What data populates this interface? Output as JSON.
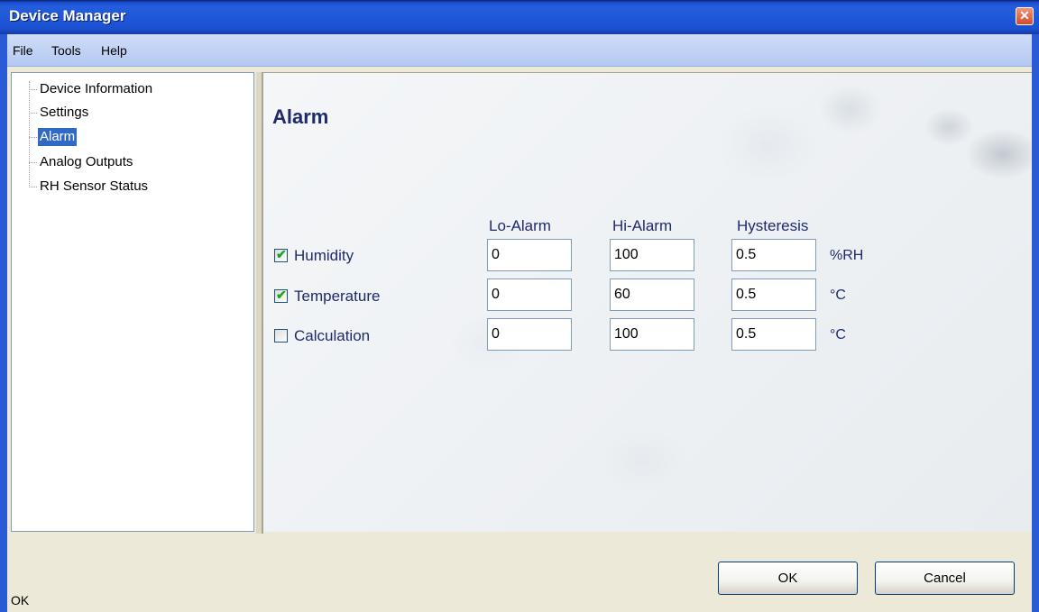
{
  "window": {
    "title": "Device Manager",
    "close_glyph": "✕"
  },
  "menu": {
    "items": [
      "File",
      "Tools",
      "Help"
    ]
  },
  "tree": {
    "items": [
      "Device Information",
      "Settings",
      "Alarm",
      "Analog Outputs",
      "RH Sensor Status"
    ],
    "selected": "Alarm"
  },
  "content": {
    "title": "Alarm",
    "headers": {
      "lo": "Lo-Alarm",
      "hi": "Hi-Alarm",
      "hyst": "Hysteresis"
    },
    "rows": [
      {
        "label": "Humidity",
        "checked": true,
        "lo": "0",
        "hi": "100",
        "hyst": "0.5",
        "unit": "%RH"
      },
      {
        "label": "Temperature",
        "checked": true,
        "lo": "0",
        "hi": "60",
        "hyst": "0.5",
        "unit": "°C"
      },
      {
        "label": "Calculation",
        "checked": false,
        "lo": "0",
        "hi": "100",
        "hyst": "0.5",
        "unit": "°C"
      }
    ]
  },
  "buttons": {
    "ok": "OK",
    "cancel": "Cancel"
  },
  "status": {
    "text": "OK"
  },
  "colors": {
    "title_bar": "#245edb",
    "selection": "#316ac5",
    "label_text": "#1f2a6b",
    "check": "#21a121"
  }
}
